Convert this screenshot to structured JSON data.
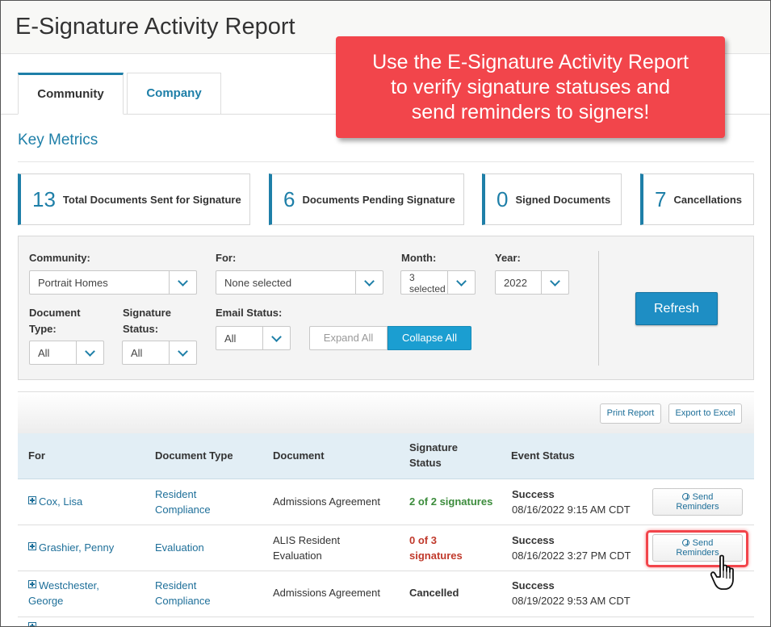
{
  "page": {
    "title": "E-Signature Activity Report"
  },
  "callout": {
    "lines": [
      "Use the E-Signature Activity Report",
      "to verify signature statuses and",
      "send reminders to signers!"
    ]
  },
  "tabs": [
    {
      "label": "Community",
      "active": true
    },
    {
      "label": "Company",
      "active": false
    }
  ],
  "key_metrics": {
    "title": "Key Metrics",
    "items": [
      {
        "value": "13",
        "label": "Total Documents Sent for Signature"
      },
      {
        "value": "6",
        "label": "Documents Pending Signature"
      },
      {
        "value": "0",
        "label": "Signed Documents"
      },
      {
        "value": "7",
        "label": "Cancellations"
      }
    ]
  },
  "filters": {
    "community": {
      "label": "Community:",
      "value": "Portrait Homes"
    },
    "for": {
      "label": "For:",
      "value": "None selected"
    },
    "month": {
      "label": "Month:",
      "value_line1": "3",
      "value_line2": "selected"
    },
    "year": {
      "label": "Year:",
      "value": "2022"
    },
    "document_type": {
      "label_line1": "Document",
      "label_line2": "Type:",
      "value": "All"
    },
    "signature_status": {
      "label_line1": "Signature",
      "label_line2": "Status:",
      "value": "All"
    },
    "email_status": {
      "label": "Email Status:",
      "value": "All"
    },
    "expand_all": "Expand All",
    "collapse_all": "Collapse All",
    "refresh": "Refresh"
  },
  "report_actions": {
    "print": "Print Report",
    "export": "Export to Excel"
  },
  "table": {
    "headers": {
      "for": "For",
      "document_type": "Document Type",
      "document": "Document",
      "signature_status_line1": "Signature",
      "signature_status_line2": "Status",
      "event_status": "Event Status"
    },
    "rows": [
      {
        "for": "Cox, Lisa",
        "doc_type_line1": "Resident",
        "doc_type_line2": "Compliance",
        "document_line1": "Admissions Agreement",
        "document_line2": "",
        "sig_line1": "2 of 2 signatures",
        "sig_line2": "",
        "event": "Success",
        "date": "08/16/2022 9:15 AM CDT",
        "reminder_line1": "Send",
        "reminder_line2": "Reminders"
      },
      {
        "for": "Grashier, Penny",
        "doc_type_line1": "Evaluation",
        "doc_type_line2": "",
        "document_line1": "ALIS Resident",
        "document_line2": "Evaluation",
        "sig_line1": "0 of 3",
        "sig_line2": "signatures",
        "event": "Success",
        "date": "08/16/2022 3:27 PM CDT",
        "reminder_line1": "Send",
        "reminder_line2": "Reminders"
      },
      {
        "for_line1": "Westchester,",
        "for_line2": "George",
        "doc_type_line1": "Resident",
        "doc_type_line2": "Compliance",
        "document_line1": "Admissions Agreement",
        "document_line2": "",
        "sig_line1": "Cancelled",
        "sig_line2": "",
        "event": "Success",
        "date": "08/19/2022 9:53 AM CDT"
      }
    ]
  },
  "colors": {
    "accent": "#1e7fa8",
    "callout": "#f2454b",
    "primary_button": "#1e8ec4",
    "success_green": "#3c8c3c",
    "pending_red": "#c0392b"
  }
}
